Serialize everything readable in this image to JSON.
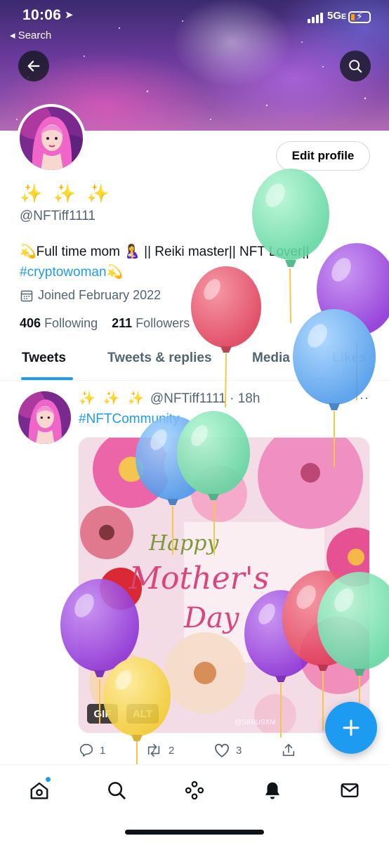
{
  "status_bar": {
    "time": "10:06",
    "location_icon": "location-arrow-icon",
    "back_label": "◂ Search",
    "network": "5G",
    "network_suffix": "E"
  },
  "header": {
    "back_icon": "arrow-left-icon",
    "search_icon": "search-icon"
  },
  "profile": {
    "edit_button": "Edit profile",
    "display_name": "✨ ✨ ✨",
    "handle": "@NFTiff1111",
    "bio_line1": "💫Full time mom 🤱 || Reiki master|| NFT Lover||",
    "bio_hashtag": "#cryptowoman",
    "bio_tail": "💫",
    "joined": "Joined February 2022",
    "following_count": "406",
    "following_label": "Following",
    "followers_count": "211",
    "followers_label": "Followers"
  },
  "tabs": [
    {
      "label": "Tweets",
      "active": true
    },
    {
      "label": "Tweets & replies",
      "active": false
    },
    {
      "label": "Media",
      "active": false
    },
    {
      "label": "Likes",
      "active": false
    }
  ],
  "tweet": {
    "display_name": "✨ ✨ ✨",
    "handle": "@NFTiff1111",
    "time": " · 18h",
    "more": "···",
    "text": "#NFTCommunity",
    "media": {
      "line1": "Happy",
      "line2": "Mother's",
      "line3": "Day",
      "watermark": "@SIRIUSXM",
      "gif_badge": "GIF",
      "alt_badge": "ALT"
    },
    "reply_count": "1",
    "retweet_count": "2",
    "like_count": "3"
  },
  "colors": {
    "accent": "#1d9bf0",
    "text_primary": "#0f1419",
    "text_secondary": "#536471"
  },
  "bottom_nav": {
    "items": [
      "home-icon",
      "search-icon",
      "spaces-icon",
      "notifications-bell-icon",
      "messages-mail-icon"
    ]
  }
}
